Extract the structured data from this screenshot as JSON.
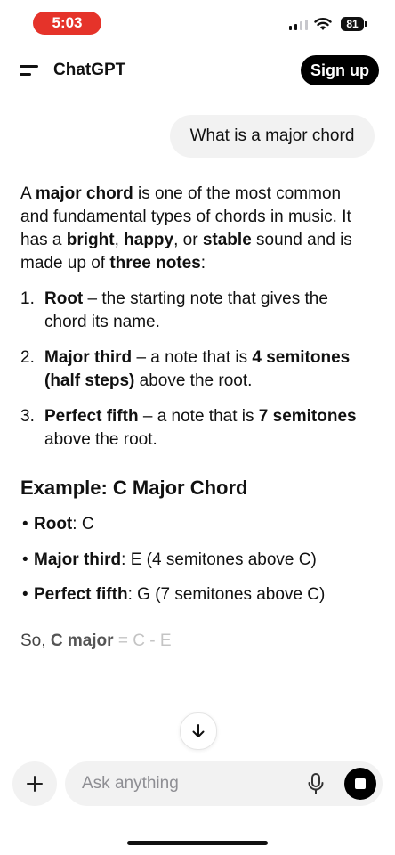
{
  "status_bar": {
    "time": "5:03",
    "battery": "81"
  },
  "header": {
    "title": "ChatGPT",
    "signup_label": "Sign up"
  },
  "user_message": "What is a major chord",
  "assistant": {
    "intro": [
      {
        "t": "A ",
        "b": false
      },
      {
        "t": "major chord",
        "b": true
      },
      {
        "t": " is one of the most common and fundamental types of chords in music. It has a ",
        "b": false
      },
      {
        "t": "bright",
        "b": true
      },
      {
        "t": ", ",
        "b": false
      },
      {
        "t": "happy",
        "b": true
      },
      {
        "t": ", or ",
        "b": false
      },
      {
        "t": "stable",
        "b": true
      },
      {
        "t": " sound and is made up of ",
        "b": false
      },
      {
        "t": "three notes",
        "b": true
      },
      {
        "t": ":",
        "b": false
      }
    ],
    "list": [
      {
        "num": "1.",
        "parts": [
          {
            "t": "Root",
            "b": true
          },
          {
            "t": " – the starting note that gives the chord its name.",
            "b": false
          }
        ]
      },
      {
        "num": "2.",
        "parts": [
          {
            "t": "Major third",
            "b": true
          },
          {
            "t": " – a note that is ",
            "b": false
          },
          {
            "t": "4 semitones (half steps)",
            "b": true
          },
          {
            "t": " above the root.",
            "b": false
          }
        ]
      },
      {
        "num": "3.",
        "parts": [
          {
            "t": "Perfect fifth",
            "b": true
          },
          {
            "t": " – a note that is ",
            "b": false
          },
          {
            "t": "7 semitones",
            "b": true
          },
          {
            "t": " above the root.",
            "b": false
          }
        ]
      }
    ],
    "example_heading": "Example: C Major Chord",
    "bullets": [
      {
        "parts": [
          {
            "t": "Root",
            "b": true
          },
          {
            "t": ": C",
            "b": false
          }
        ]
      },
      {
        "parts": [
          {
            "t": "Major third",
            "b": true
          },
          {
            "t": ": E (4 semitones above C)",
            "b": false
          }
        ]
      },
      {
        "parts": [
          {
            "t": "Perfect fifth",
            "b": true
          },
          {
            "t": ": G (7 semitones above C)",
            "b": false
          }
        ]
      }
    ],
    "streaming_line": [
      {
        "t": "So, ",
        "b": false,
        "c": "#444444"
      },
      {
        "t": "C major",
        "b": true,
        "c": "#555555"
      },
      {
        "t": " = C - E",
        "b": false,
        "c": "#c4c4c4"
      }
    ]
  },
  "input": {
    "placeholder": "Ask anything"
  },
  "icons": {
    "menu": "menu-icon",
    "scroll": "arrow-down-icon",
    "plus": "plus-icon",
    "mic": "microphone-icon",
    "stop": "stop-icon",
    "signal": "cellular-signal-icon",
    "wifi": "wifi-icon",
    "battery": "battery-icon"
  },
  "colors": {
    "status_time_bg": "#e5332a",
    "bubble_bg": "#f2f2f2",
    "button_dark": "#000000"
  }
}
